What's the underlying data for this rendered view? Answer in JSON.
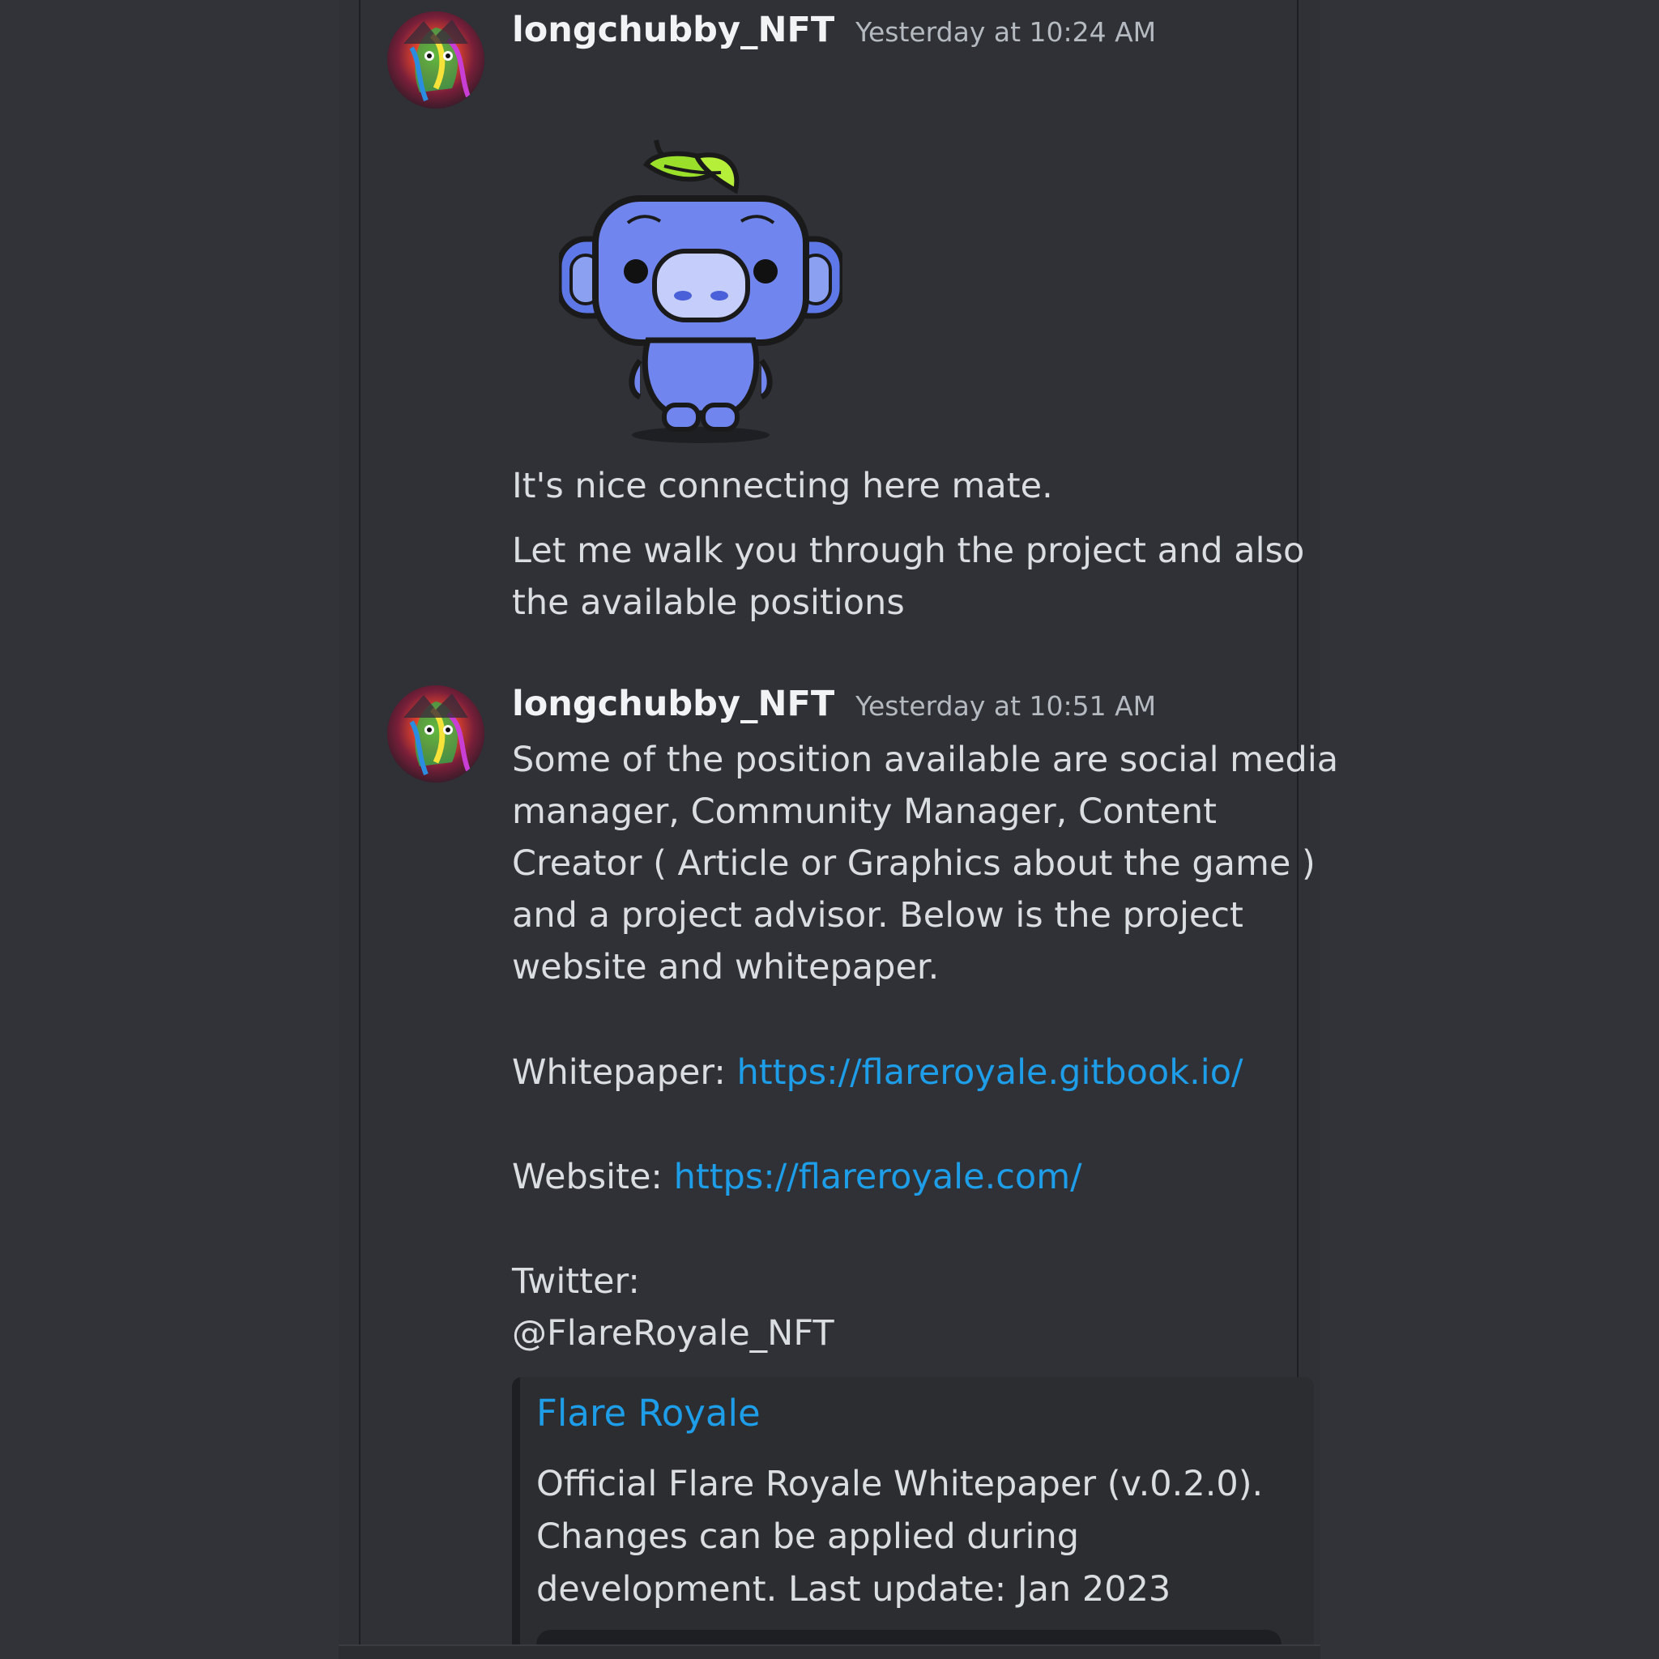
{
  "colors": {
    "background": "#313338",
    "chat_background": "#2f3136",
    "username": "#f2f3f5",
    "timestamp": "#b5bac1",
    "message_text": "#dbdee1",
    "link": "#1e9ee8",
    "embed_background": "#2b2d31"
  },
  "messages": [
    {
      "username": "longchubby_NFT",
      "timestamp": "Yesterday at 10:24 AM",
      "avatar_icon": "colorful-nft-avatar",
      "sticker": "wumpus-leaf-sticker",
      "lines": [
        "It's nice connecting here mate.",
        "Let me walk you through the project and also",
        "the available positions"
      ]
    },
    {
      "username": "longchubby_NFT",
      "timestamp": "Yesterday at 10:51 AM",
      "avatar_icon": "colorful-nft-avatar",
      "lines": [
        "Some of the position available are social media",
        "manager, Community Manager, Content",
        "Creator ( Article or Graphics about the game )",
        "and a project advisor. Below is the project",
        "website and whitepaper."
      ],
      "whitepaper": {
        "label": "Whitepaper:",
        "url": "https://flareroyale.gitbook.io/"
      },
      "website": {
        "label": "Website:",
        "url": "https://flareroyale.com/"
      },
      "twitter": {
        "label": "Twitter:",
        "handle": "@FlareRoyale_NFT"
      },
      "embed": {
        "title": "Flare Royale",
        "description_lines": [
          "Official Flare Royale Whitepaper (v.0.2.0).",
          "Changes can be applied during",
          "development. Last update: Jan 2023"
        ]
      }
    }
  ]
}
